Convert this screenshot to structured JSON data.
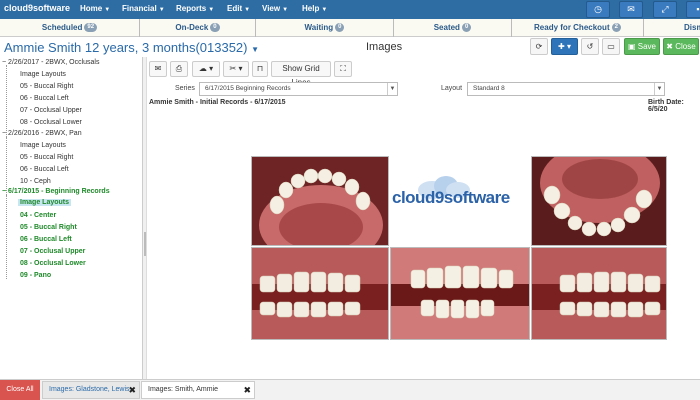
{
  "app": {
    "brand": "cloud9software"
  },
  "nav": {
    "menus": [
      "Home",
      "Financial",
      "Reports",
      "Edit",
      "View",
      "Help"
    ]
  },
  "statusbar": [
    {
      "label": "Scheduled",
      "count": "92"
    },
    {
      "label": "On-Deck",
      "count": "0"
    },
    {
      "label": "Waiting",
      "count": "0"
    },
    {
      "label": "Seated",
      "count": "0"
    },
    {
      "label": "Ready for Checkout",
      "count": "2"
    },
    {
      "label": "Dism",
      "count": ""
    }
  ],
  "header": {
    "patient": "Ammie Smith 12 years, 3 months(013352)",
    "page_title": "Images",
    "save_label": "Save",
    "close_label": "Close"
  },
  "tree": {
    "groups": [
      {
        "label": "2/26/2017 - 2BWX, Occlusals",
        "items": [
          "Image Layouts",
          "05 - Buccal Right",
          "06 - Buccal Left",
          "07 - Occlusal Upper",
          "08 - Occlusal Lower"
        ]
      },
      {
        "label": "2/26/2016 - 2BWX, Pan",
        "items": [
          "Image Layouts",
          "05 - Buccal Right",
          "06 - Buccal Left",
          "10 - Ceph"
        ]
      },
      {
        "label": "6/17/2015 - Beginning Records",
        "items": [
          "Image Layouts",
          "04 - Center",
          "05 - Buccal Right",
          "06 - Buccal Left",
          "07 - Occlusal Upper",
          "08 - Occlusal Lower",
          "09 - Pano"
        ]
      }
    ]
  },
  "toolbar": {
    "grid_label": "Show Grid Lines",
    "series_label": "Series",
    "series_value": "6/17/2015 Beginning Records",
    "layout_label": "Layout",
    "layout_value": "Standard 8"
  },
  "record": {
    "title": "Ammie Smith - Initial Records - 6/17/2015",
    "birth": "Birth Date: 6/5/20"
  },
  "images": {
    "logo": "cloud9software"
  },
  "bottom": {
    "close_all": "Close All",
    "tabs": [
      "Images: Gladstone, Lewis",
      "Images: Smith, Ammie"
    ]
  },
  "colors": {
    "nav": "#2e6da4",
    "accent": "#2a6aa8",
    "green": "#1f8a2a",
    "danger": "#d9534f"
  },
  "icons": [
    "clock-icon",
    "mail-icon",
    "expand-icon",
    "lock-icon",
    "refresh-icon",
    "plus-icon",
    "history-icon",
    "monitor-icon",
    "save-icon",
    "close-icon",
    "envelope-icon",
    "print-icon",
    "cloud-upload-icon",
    "tools-icon",
    "unlock-icon",
    "fullscreen-icon"
  ]
}
